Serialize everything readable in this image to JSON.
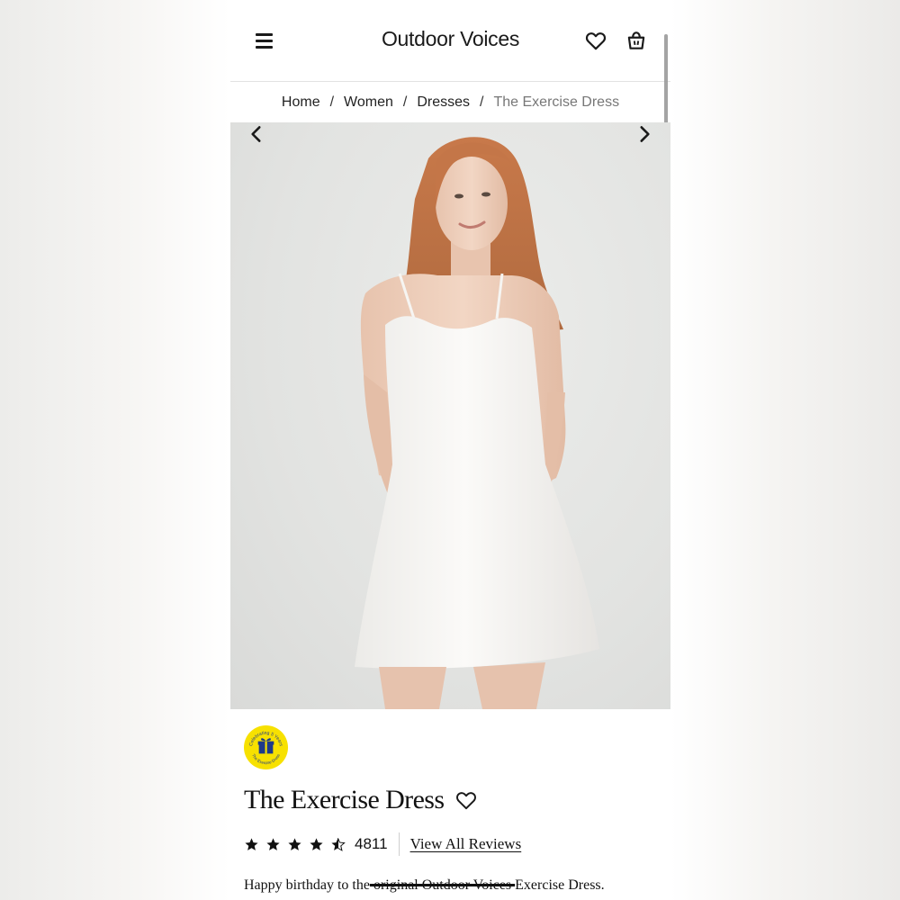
{
  "header": {
    "brand": "Outdoor Voices",
    "icons": [
      "menu-icon",
      "heart-icon",
      "shopping-bag-icon"
    ]
  },
  "breadcrumb": {
    "items": [
      "Home",
      "Women",
      "Dresses"
    ],
    "separator": "/",
    "current": "The Exercise Dress"
  },
  "gallery": {
    "prev_icon": "chevron-left-icon",
    "next_icon": "chevron-right-icon",
    "image": "model-wearing-white-exercise-dress"
  },
  "badge": {
    "top_text": "Celebrating 5 Years",
    "bottom_text": "The Exercise Dress",
    "icon": "gift-icon",
    "color": "#f7e100"
  },
  "product": {
    "title": "The Exercise Dress",
    "rating_stars": 4.5,
    "review_count": "4811",
    "view_reviews_label": "View All Reviews",
    "description_before": "Happy birthday to the",
    "description_struck": " original Outdoor Voices ",
    "description_after": "Exercise Dress."
  },
  "colors": {
    "text": "#1a1a1a",
    "breadcrumb_current": "#777777",
    "badge_yellow": "#f7e100"
  }
}
